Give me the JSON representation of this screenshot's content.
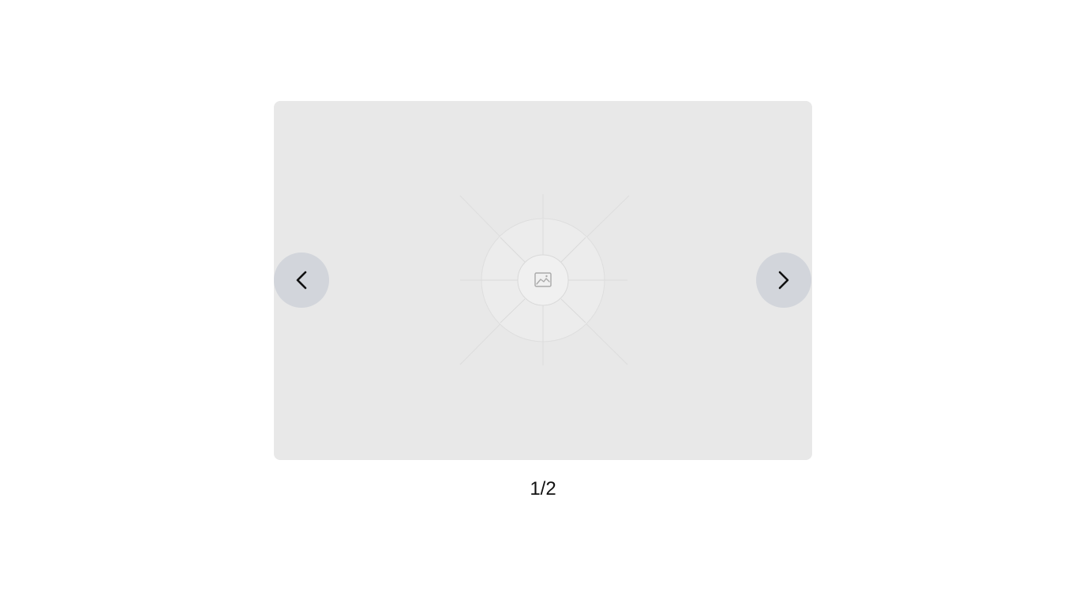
{
  "carousel": {
    "slide": {
      "placeholder_icon": "image-icon",
      "background_color": "#e8e8e8"
    },
    "prev_button": {
      "icon": "chevron-left-icon",
      "background_color": "#d2d5db"
    },
    "next_button": {
      "icon": "chevron-right-icon",
      "background_color": "#d2d5db"
    },
    "current_slide": 1,
    "total_slides": 2,
    "counter_text": "1/2"
  }
}
